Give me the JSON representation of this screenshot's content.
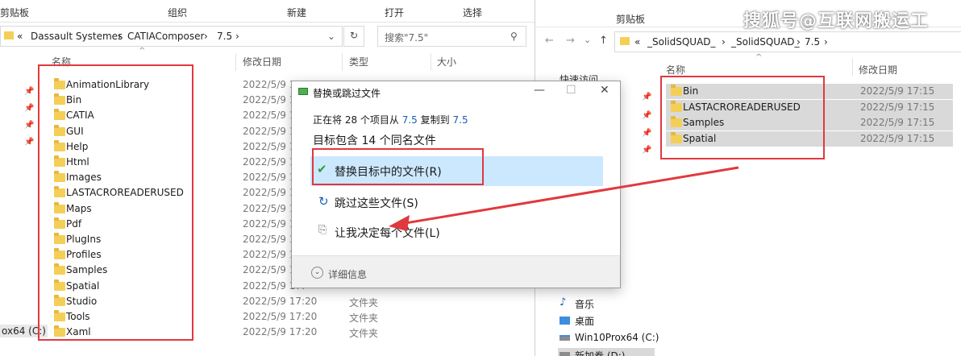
{
  "left_explorer": {
    "ribbon": [
      "剪贴板",
      "组织",
      "新建",
      "打开",
      "选择"
    ],
    "breadcrumb": [
      "«",
      "Dassault Systemes",
      "›",
      "CATIAComposer",
      "›",
      "7.5",
      "›"
    ],
    "search_placeholder": "搜索\"7.5\"",
    "columns": {
      "name": "名称",
      "date": "修改日期",
      "type": "类型",
      "size": "大小"
    },
    "files": [
      {
        "name": "AnimationLibrary",
        "date": "2022/5/9 17:",
        "type": ""
      },
      {
        "name": "Bin",
        "date": "2022/5/9 17:",
        "type": ""
      },
      {
        "name": "CATIA",
        "date": "2022/5/9 17:",
        "type": ""
      },
      {
        "name": "GUI",
        "date": "2022/5/9 17:",
        "type": ""
      },
      {
        "name": "Help",
        "date": "2022/5/9 17:",
        "type": ""
      },
      {
        "name": "Html",
        "date": "2022/5/9 17:",
        "type": ""
      },
      {
        "name": "Images",
        "date": "2022/5/9 17:",
        "type": ""
      },
      {
        "name": "LASTACROREADERUSED",
        "date": "2022/5/9 17:",
        "type": ""
      },
      {
        "name": "Maps",
        "date": "2022/5/9 17:",
        "type": ""
      },
      {
        "name": "Pdf",
        "date": "2022/5/9 17:",
        "type": ""
      },
      {
        "name": "PlugIns",
        "date": "2022/5/9 17:",
        "type": ""
      },
      {
        "name": "Profiles",
        "date": "2022/5/9 17:",
        "type": ""
      },
      {
        "name": "Samples",
        "date": "2022/5/9 17:",
        "type": ""
      },
      {
        "name": "Spatial",
        "date": "2022/5/9 17:",
        "type": ""
      },
      {
        "name": "Studio",
        "date": "2022/5/9 17:20",
        "type": "文件夹"
      },
      {
        "name": "Tools",
        "date": "2022/5/9 17:20",
        "type": "文件夹"
      },
      {
        "name": "Xaml",
        "date": "2022/5/9 17:20",
        "type": "文件夹"
      }
    ],
    "drive_label": "ox64 (C:)"
  },
  "right_explorer": {
    "ribbon_top": [
      "",
      "",
      "剪贴板"
    ],
    "breadcrumb": [
      "«",
      "_SolidSQUAD_",
      "›",
      "_SolidSQUAD_",
      "›",
      "7.5",
      "›"
    ],
    "columns": {
      "name": "名称",
      "date": "修改日期"
    },
    "nav_quick": "快速访问",
    "files": [
      {
        "name": "Bin",
        "date": "2022/5/9 17:15"
      },
      {
        "name": "LASTACROREADERUSED",
        "date": "2022/5/9 17:15"
      },
      {
        "name": "Samples",
        "date": "2022/5/9 17:15"
      },
      {
        "name": "Spatial",
        "date": "2022/5/9 17:15"
      }
    ],
    "nav_items": [
      {
        "icon": "music-icon",
        "label": "音乐"
      },
      {
        "icon": "desktop-icon",
        "label": "桌面"
      },
      {
        "icon": "drive-icon",
        "label": "Win10Prox64 (C:)"
      },
      {
        "icon": "drive-icon",
        "label": "新加卷 (D:)"
      }
    ]
  },
  "dialog": {
    "title": "替换或跳过文件",
    "progress_prefix": "正在将 28 个项目从",
    "progress_src": "7.5",
    "progress_mid": "复制到",
    "progress_dst": "7.5",
    "heading": "目标包含 14 个同名文件",
    "options": [
      {
        "icon": "checkmark-icon",
        "label": "替换目标中的文件(R)"
      },
      {
        "icon": "skip-icon",
        "label": "跳过这些文件(S)"
      },
      {
        "icon": "decide-icon",
        "label": "让我决定每个文件(L)"
      }
    ],
    "details": "详细信息"
  },
  "watermark": "搜狐号@互联网搬运工",
  "colors": {
    "annotation": "#e0393e",
    "link": "#1a5fb4",
    "highlight": "#cce8ff"
  }
}
